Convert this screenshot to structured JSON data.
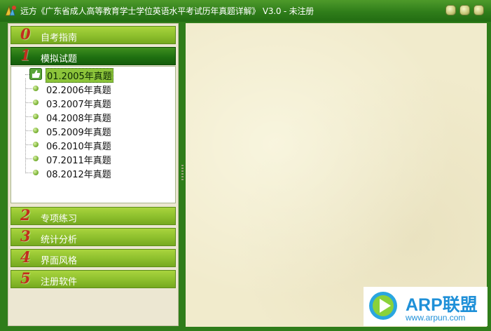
{
  "window": {
    "title": "远方《广东省成人高等教育学士学位英语水平考试历年真题详解》 V3.0 - 未注册",
    "buttons": [
      "minimize",
      "maximize",
      "close"
    ]
  },
  "sections": [
    {
      "num": "0",
      "label": "自考指南"
    },
    {
      "num": "1",
      "label": "模拟试题"
    },
    {
      "num": "2",
      "label": "专项练习"
    },
    {
      "num": "3",
      "label": "统计分析"
    },
    {
      "num": "4",
      "label": "界面风格"
    },
    {
      "num": "5",
      "label": "注册软件"
    }
  ],
  "active_section": "模拟试题",
  "tree": {
    "items": [
      {
        "label": "01.2005年真题"
      },
      {
        "label": "02.2006年真题"
      },
      {
        "label": "03.2007年真题"
      },
      {
        "label": "04.2008年真题"
      },
      {
        "label": "05.2009年真题"
      },
      {
        "label": "06.2010年真题"
      },
      {
        "label": "07.2011年真题"
      },
      {
        "label": "08.2012年真题"
      }
    ],
    "selected": "01.2005年真题"
  },
  "watermark": {
    "brand": "ARP联盟",
    "url": "www.arpun.com"
  }
}
